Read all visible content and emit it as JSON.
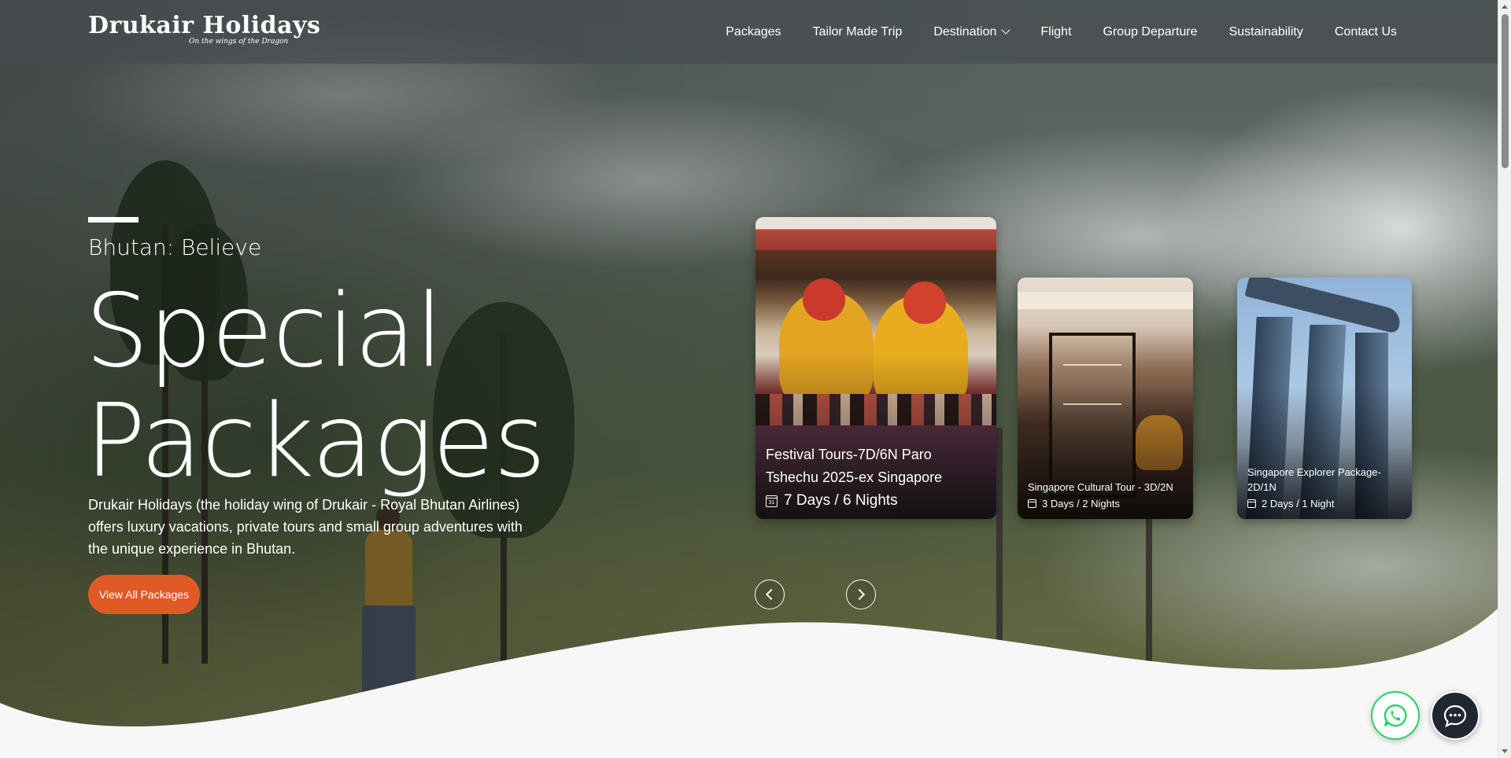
{
  "brand": {
    "name": "Drukair Holidays",
    "tagline": "On the wings of the Dragon"
  },
  "nav": {
    "items": [
      {
        "label": "Packages"
      },
      {
        "label": "Tailor Made Trip"
      },
      {
        "label": "Destination",
        "has_dropdown": true
      },
      {
        "label": "Flight"
      },
      {
        "label": "Group Departure"
      },
      {
        "label": "Sustainability"
      },
      {
        "label": "Contact Us"
      }
    ]
  },
  "hero": {
    "eyebrow": "Bhutan: Believe",
    "title_line1": "Special",
    "title_line2": "Packages",
    "description": "Drukair Holidays (the holiday wing of Drukair - Royal Bhutan Airlines) offers luxury vacations, private tours and small group adventures with the unique experience in Bhutan.",
    "cta_label": "View All Packages"
  },
  "packages": [
    {
      "title": "Festival Tours-7D/6N Paro Tshechu 2025-ex Singapore",
      "duration": "7 Days / 6 Nights",
      "icon": "calendar-icon"
    },
    {
      "title": "Singapore Cultural Tour - 3D/2N",
      "duration": "3 Days / 2 Nights",
      "icon": "calendar-icon"
    },
    {
      "title": "Singapore Explorer Package-2D/1N",
      "duration": "2 Days / 1 Night",
      "icon": "calendar-icon"
    }
  ],
  "calendar_glyph": "31",
  "floating": {
    "whatsapp_icon": "whatsapp-icon",
    "chat_icon": "chat-bubble-icon"
  },
  "colors": {
    "accent": "#e05a25",
    "whatsapp": "#25d366",
    "chat_bg": "#1f2733",
    "footer_bg": "#f7f7f7"
  }
}
